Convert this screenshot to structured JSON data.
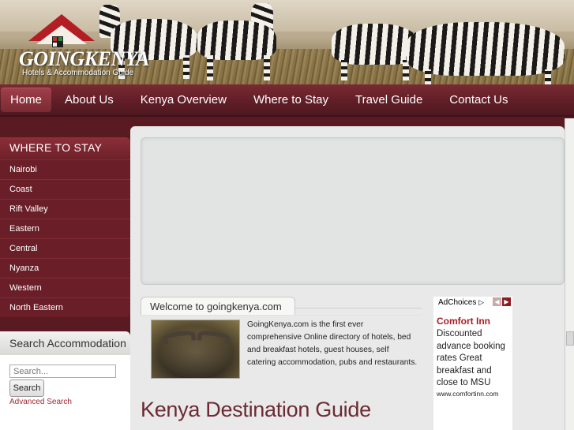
{
  "logo": {
    "wordmark": "GOINGKENYA",
    "tagline": "Hotels & Accommodation Guide"
  },
  "nav": {
    "items": [
      {
        "label": "Home",
        "active": true
      },
      {
        "label": "About Us"
      },
      {
        "label": "Kenya Overview"
      },
      {
        "label": "Where to Stay"
      },
      {
        "label": "Travel Guide"
      },
      {
        "label": "Contact Us"
      }
    ]
  },
  "sidebar": {
    "where_to_stay_title": "WHERE TO STAY",
    "regions": [
      "Nairobi",
      "Coast",
      "Rift Valley",
      "Eastern",
      "Central",
      "Nyanza",
      "Western",
      "North Eastern"
    ],
    "search_title": "Search Accommodation",
    "search_placeholder": "Search...",
    "search_button": "Search",
    "advanced_search": "Advanced Search"
  },
  "main": {
    "welcome_title": "Welcome to goingkenya.com",
    "intro_text": "GoingKenya.com is the first ever comprehensive Online directory of hotels, bed and breakfast hotels, guest houses, self catering accommodation, pubs and restaurants.",
    "destination_title": "Kenya Destination Guide"
  },
  "ad": {
    "adchoices_label": "AdChoices",
    "title": "Comfort Inn",
    "body": "Discounted advance booking rates Great breakfast and close to MSU",
    "url": "www.comfortinn.com"
  },
  "colors": {
    "brand_maroon": "#5a1a22",
    "nav_bg": "#6e2029",
    "heading_text": "#6b2a34",
    "ad_title": "#a51c24"
  }
}
